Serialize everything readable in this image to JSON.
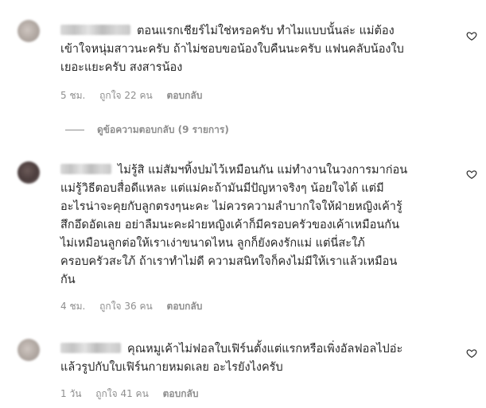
{
  "comments": [
    {
      "text": "ตอนแรกเชียร์ไม่ใช่หรอครับ ทำไมแบบนั้นล่ะ แม่ต้อง\nเข้าใจหนุ่มสาวนะครับ ถ้าไม่ชอบขอน้องใบคืนนะครับ แฟนคลับน้องใบ\nเยอะแยะครับ สงสารน้อง",
      "time": "5 ชม.",
      "likes": "ถูกใจ 22 คน",
      "reply": "ตอบกลับ"
    },
    {
      "text": "ไม่รู้สิ แม่สัมฯทิ้งปมไว้เหมือนกัน แม่ทำงานในวงการมาก่อน\nแม่รู้วิธีตอบสื่อดีแหละ แต่แม่คะถ้ามันมีปัญหาจริงๆ น้อยใจได้ แต่มี\nอะไรน่าจะคุยกับลูกตรงๆนะคะ ไม่ควรความลำบากใจให้ฝ่ายหญิงเค้ารู้\nสึกอึดอัดเลย อย่าลืมนะคะฝ่ายหญิงเค้าก็มีครอบครัวของเค้าเหมือนกัน\nไม่เหมือนลูกต่อให้เราเง่าขนาดไหน ลูกก็ยังคงรักแม่ แต่นี่สะใภ้\nครอบครัวสะใภ้ ถ้าเราทำไม่ดี ความสนิทใจก็คงไม่มีให้เราแล้วเหมือน\nกัน",
      "time": "4 ชม.",
      "likes": "ถูกใจ 36 คน",
      "reply": "ตอบกลับ"
    },
    {
      "text": "คุณหมูเค้าไม่ฟอลใบเฟิร์นตั้งแต่แรกหรือเพิ่งอัลฟอลไปอ่ะ\nแล้วรูปกับใบเฟิร์นกายหมดเลย อะไรยังไงครับ",
      "time": "1 วัน",
      "likes": "ถูกใจ 41 คน",
      "reply": "ตอบกลับ"
    }
  ],
  "view_replies": "ดูข้อความตอบกลับ (9 รายการ)",
  "icons": {
    "like": "heart-outline-icon"
  },
  "colors": {
    "text": "#262626",
    "meta": "#8e8e8e",
    "background": "#ffffff"
  }
}
